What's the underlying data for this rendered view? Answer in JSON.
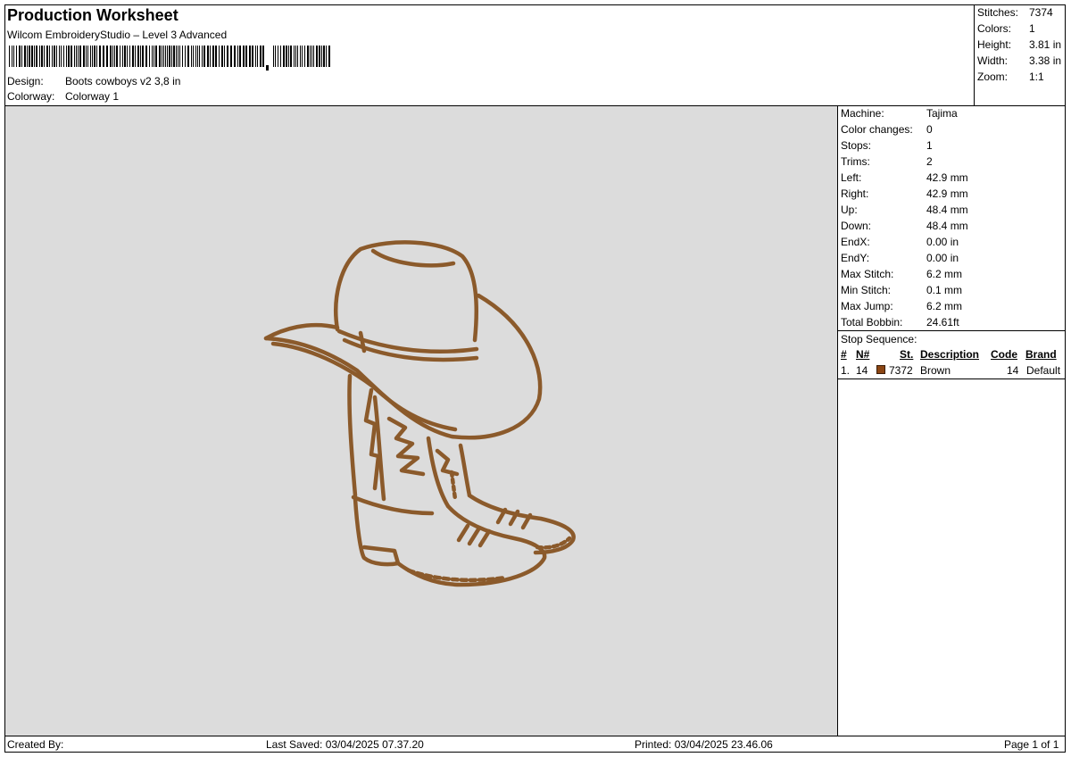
{
  "header": {
    "title": "Production Worksheet",
    "software": "Wilcom EmbroideryStudio – Level 3 Advanced",
    "design_label": "Design:",
    "design_value": "Boots  cowboys v2 3,8 in",
    "colorway_label": "Colorway:",
    "colorway_value": "Colorway 1"
  },
  "summary": {
    "stitches_label": "Stitches:",
    "stitches": "7374",
    "colors_label": "Colors:",
    "colors": "1",
    "height_label": "Height:",
    "height": "3.81 in",
    "width_label": "Width:",
    "width": "3.38 in",
    "zoom_label": "Zoom:",
    "zoom": "1:1"
  },
  "machine": {
    "machine_label": "Machine:",
    "machine": "Tajima",
    "color_changes_label": "Color changes:",
    "color_changes": "0",
    "stops_label": "Stops:",
    "stops": "1",
    "trims_label": "Trims:",
    "trims": "2",
    "left_label": "Left:",
    "left": "42.9 mm",
    "right_label": "Right:",
    "right": "42.9 mm",
    "up_label": "Up:",
    "up": "48.4 mm",
    "down_label": "Down:",
    "down": "48.4 mm",
    "endx_label": "EndX:",
    "endx": "0.00 in",
    "endy_label": "EndY:",
    "endy": "0.00 in",
    "max_stitch_label": "Max Stitch:",
    "max_stitch": "6.2 mm",
    "min_stitch_label": "Min Stitch:",
    "min_stitch": "0.1 mm",
    "max_jump_label": "Max Jump:",
    "max_jump": "6.2 mm",
    "total_bobbin_label": "Total Bobbin:",
    "total_bobbin": "24.61ft"
  },
  "stop_sequence": {
    "title": "Stop Sequence:",
    "headers": {
      "num": "#",
      "n": "N#",
      "st": "St.",
      "description": "Description",
      "code": "Code",
      "brand": "Brand"
    },
    "rows": [
      {
        "num": "1.",
        "n": "14",
        "st": "7372",
        "description": "Brown",
        "code": "14",
        "brand": "Default",
        "color": "#8b4513"
      }
    ]
  },
  "footer": {
    "created_by": "Created By:",
    "last_saved": "Last Saved: 03/04/2025 07.37.20",
    "printed": "Printed: 03/04/2025 23.46.06",
    "page": "Page 1 of 1"
  },
  "design_colors": {
    "thread": "#8b5a2b",
    "thread_dark": "#5e3a17",
    "canvas": "#dcdcdc"
  }
}
